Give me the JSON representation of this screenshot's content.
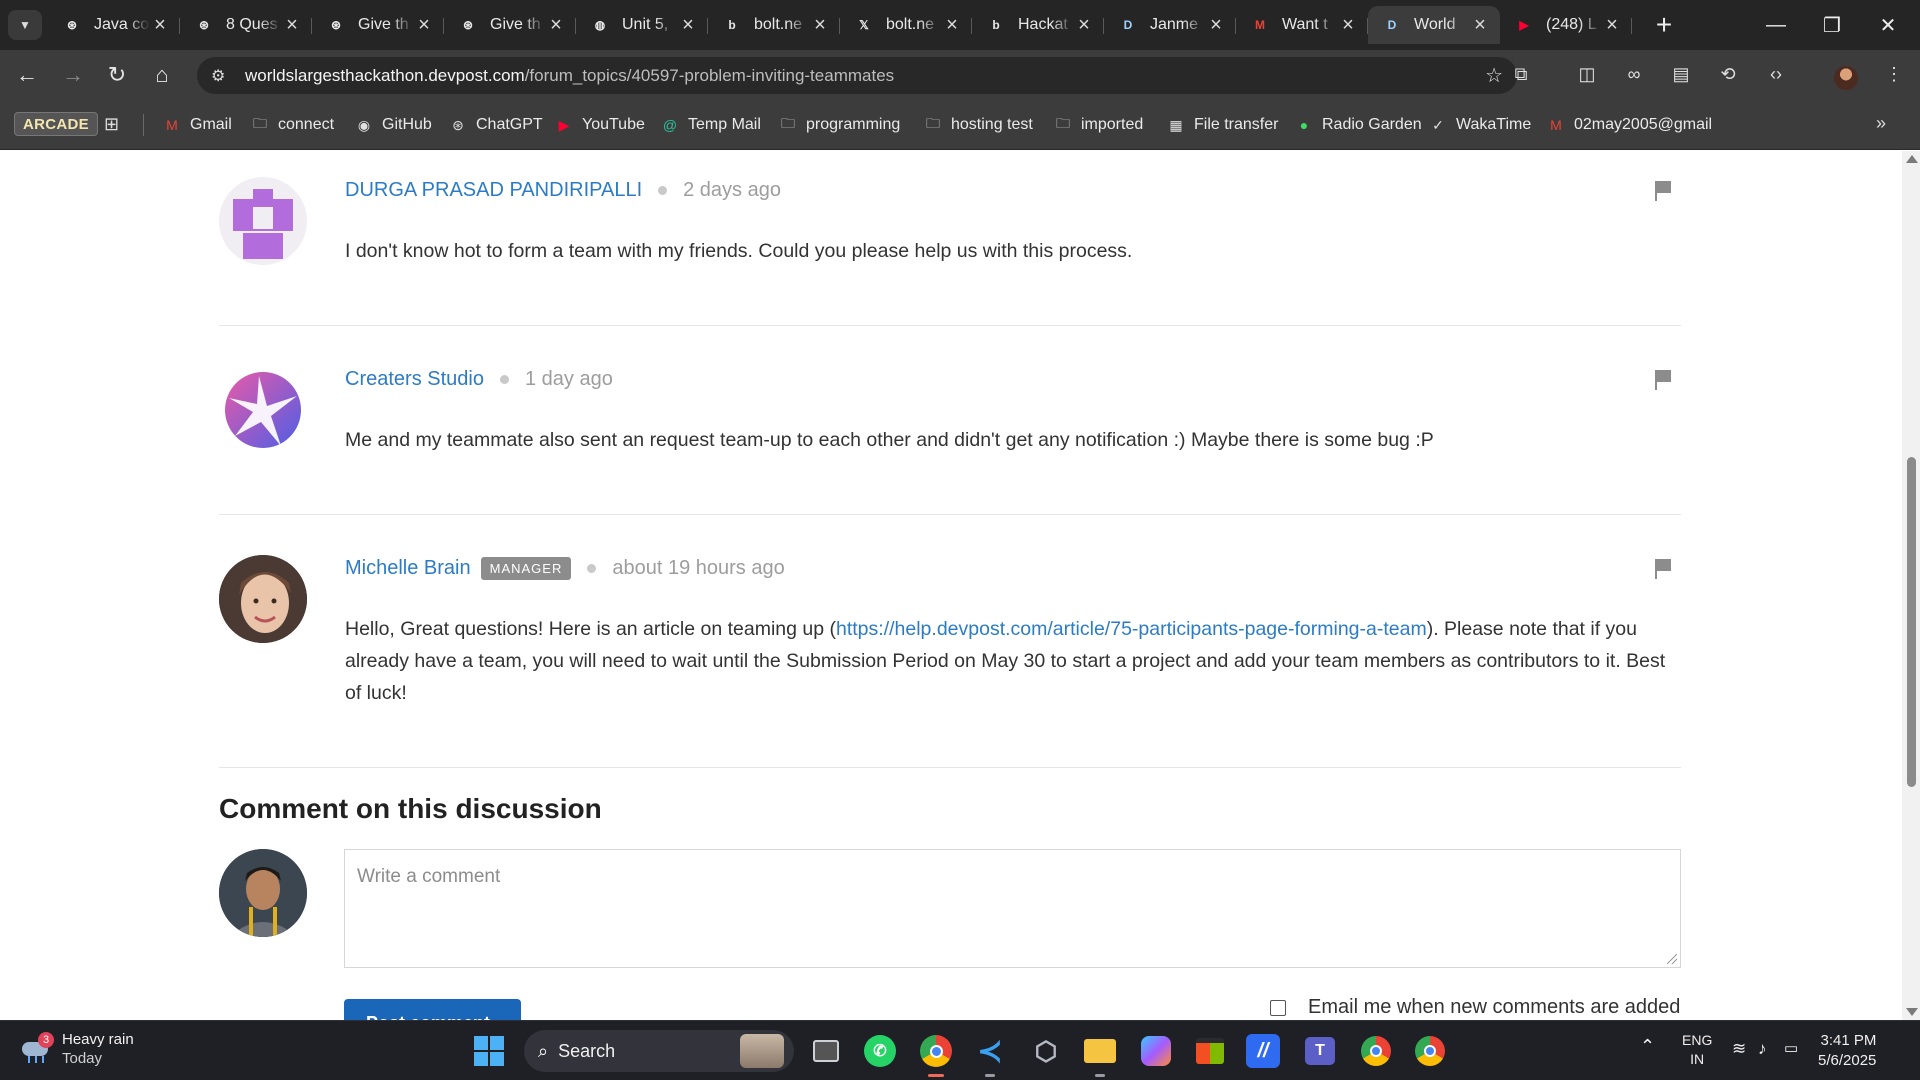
{
  "browser": {
    "tabs": [
      {
        "title": "Java co",
        "icon": "openai-icon",
        "color": "#e8e8e8",
        "glyph": "⊛"
      },
      {
        "title": "8 Ques",
        "icon": "openai-icon",
        "color": "#e8e8e8",
        "glyph": "⊛"
      },
      {
        "title": "Give th",
        "icon": "openai-icon",
        "color": "#e8e8e8",
        "glyph": "⊛"
      },
      {
        "title": "Give th",
        "icon": "openai-icon",
        "color": "#e8e8e8",
        "glyph": "⊛"
      },
      {
        "title": "Unit 5,",
        "icon": "globe-icon",
        "color": "#e8e8e8",
        "glyph": "◍"
      },
      {
        "title": "bolt.ne",
        "icon": "bolt-icon",
        "color": "#e8e8e8",
        "glyph": "b"
      },
      {
        "title": "bolt.ne",
        "icon": "x-icon",
        "color": "#e8e8e8",
        "glyph": "𝕏"
      },
      {
        "title": "Hackat",
        "icon": "bolt-icon",
        "color": "#e8e8e8",
        "glyph": "b"
      },
      {
        "title": "Janme",
        "icon": "devpost-icon",
        "color": "#9fd0ff",
        "glyph": "D"
      },
      {
        "title": "Want t",
        "icon": "gmail-icon",
        "color": "#ea4335",
        "glyph": "M"
      },
      {
        "title": "World",
        "icon": "devpost-icon",
        "color": "#9fd0ff",
        "glyph": "D",
        "active": true
      },
      {
        "title": "(248) L",
        "icon": "youtube-icon",
        "color": "#ff0033",
        "glyph": "▶"
      }
    ],
    "url_host": "worldslargesthackathon.devpost.com",
    "url_path": "/forum_topics/40597-problem-inviting-teammates"
  },
  "bookmarks": {
    "arcade": "ARCADE",
    "items": [
      {
        "label": "Gmail",
        "icon": "gmail-icon",
        "color": "#ea4335",
        "glyph": "M"
      },
      {
        "label": "connect",
        "icon": "folder-icon",
        "color": "#e0e0e0",
        "glyph": "🗀"
      },
      {
        "label": "GitHub",
        "icon": "github-icon",
        "color": "#e0e0e0",
        "glyph": "◉"
      },
      {
        "label": "ChatGPT",
        "icon": "openai-icon",
        "color": "#e0e0e0",
        "glyph": "⊛"
      },
      {
        "label": "YouTube",
        "icon": "youtube-icon",
        "color": "#ff0033",
        "glyph": "▶"
      },
      {
        "label": "Temp Mail",
        "icon": "tempmail-icon",
        "color": "#2fbf9a",
        "glyph": "@"
      },
      {
        "label": "programming",
        "icon": "folder-icon",
        "color": "#e0e0e0",
        "glyph": "🗀"
      },
      {
        "label": "hosting test",
        "icon": "folder-icon",
        "color": "#e0e0e0",
        "glyph": "🗀"
      },
      {
        "label": "imported",
        "icon": "folder-icon",
        "color": "#e0e0e0",
        "glyph": "🗀"
      },
      {
        "label": "File transfer",
        "icon": "file-transfer-icon",
        "color": "#e0e0e0",
        "glyph": "▦"
      },
      {
        "label": "Radio Garden",
        "icon": "radio-garden-icon",
        "color": "#3ddc64",
        "glyph": "●"
      },
      {
        "label": "WakaTime",
        "icon": "wakatime-icon",
        "color": "#e0e0e0",
        "glyph": "✓"
      },
      {
        "label": "02may2005@gmail",
        "icon": "gmail-icon",
        "color": "#ea4335",
        "glyph": "M"
      }
    ]
  },
  "comments": [
    {
      "author": "DURGA PRASAD PANDIRIPALLI",
      "time": "2 days ago",
      "badge": "",
      "body": "I don't know hot to form a team with my friends. Could you please help us with this process."
    },
    {
      "author": "Creaters Studio",
      "time": "1 day ago",
      "badge": "",
      "body": "Me and my teammate also sent an request team-up to each other and didn't get any notification :) Maybe there is some bug :P"
    },
    {
      "author": "Michelle Brain",
      "time": "about 19 hours ago",
      "badge": "MANAGER",
      "body_pre": "Hello, Great questions! Here is an article on teaming up (",
      "link": "https://help.devpost.com/article/75-participants-page-forming-a-team",
      "body_post": "). Please note that if you already have a team, you will need to wait until the Submission Period on May 30 to start a project and add your team members as contributors to it. Best of luck!"
    }
  ],
  "compose": {
    "title": "Comment on this discussion",
    "placeholder": "Write a comment",
    "post_label": "Post comment",
    "email_label": "Email me when new comments are added"
  },
  "taskbar": {
    "weather_title": "Heavy rain",
    "weather_sub": "Today",
    "weather_badge": "3",
    "search_label": "Search",
    "lang_1": "ENG",
    "lang_2": "IN",
    "time": "3:41 PM",
    "date": "5/6/2025"
  },
  "colors": {
    "link": "#2c7cc5",
    "post_button": "#1a66b8",
    "windows_blue": "#4cb2f5"
  }
}
